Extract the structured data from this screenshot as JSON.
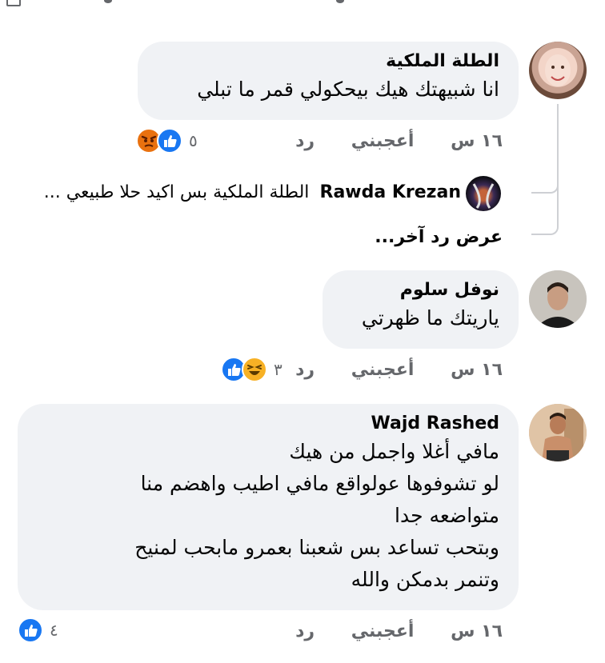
{
  "comments": [
    {
      "author": "الطلة الملكية",
      "text": "انا شبيهتك هيك بيحكولي قمر ما تبلي",
      "time": "١٦ س",
      "like": "أعجبني",
      "reply": "رد",
      "react_count": "٥",
      "reactions": [
        "angry-icon",
        "like-icon"
      ]
    },
    {
      "author": "نوفل سلوم",
      "text": "ياريتك ما ظهرتي",
      "time": "١٦ س",
      "like": "أعجبني",
      "reply": "رد",
      "react_count": "٣",
      "reactions": [
        "haha-icon",
        "like-icon"
      ]
    },
    {
      "author": "Wajd Rashed",
      "lines": [
        "مافي أغلا واجمل من هيك",
        "لو تشوفوها عولواقع مافي اطيب واهضم منا",
        "متواضعه جدا",
        "وبتحب تساعد بس شعبنا بعمرو مابحب لمنيح",
        "وتنمر بدمكن والله"
      ],
      "time": "١٦ س",
      "like": "أعجبني",
      "reply": "رد",
      "react_count": "٤",
      "reactions": [
        "like-icon"
      ]
    }
  ],
  "reply_preview": {
    "author": "Rawda Krezan",
    "text": "الطلة الملكية بس اكيد حلا طبيعي ..."
  },
  "more_replies": "عرض رد آخر...",
  "colors": {
    "bubble": "#f0f2f5",
    "meta": "#65676b",
    "like_blue": "#1877f2",
    "haha_yellow": "#f7b125",
    "angry_red": "#e9710f"
  }
}
